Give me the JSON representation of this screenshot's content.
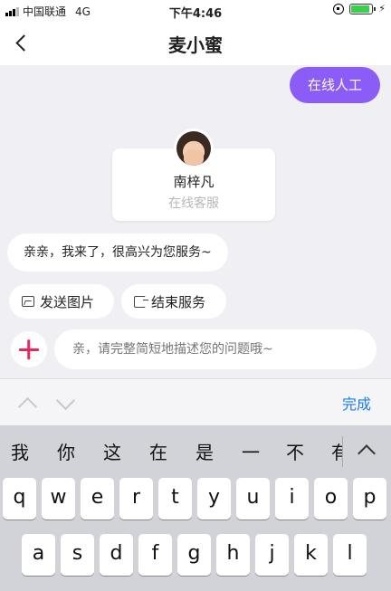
{
  "status_bar": {
    "carrier": "中国联通",
    "network": "4G",
    "time": "下午4:46",
    "battery_level": 0.9,
    "icons": [
      "signal-icon",
      "orientation-lock-icon",
      "battery-icon",
      "charging-icon"
    ]
  },
  "nav": {
    "title": "麦小蜜",
    "back_icon": "chevron-left-icon"
  },
  "chat": {
    "online_button_label": "在线人工",
    "agent_name": "南梓凡",
    "agent_role": "在线客服",
    "greeting": "亲亲，我来了，很高兴为您服务~"
  },
  "actions": {
    "send_image_label": "发送图片",
    "end_service_label": "结束服务"
  },
  "composer": {
    "placeholder": "亲，请完整简短地描述您的问题哦~"
  },
  "keyboard_bar": {
    "done_label": "完成"
  },
  "keyboard": {
    "candidates": [
      "我",
      "你",
      "这",
      "在",
      "是",
      "一",
      "不",
      "有"
    ],
    "row1": [
      "q",
      "w",
      "e",
      "r",
      "t",
      "y",
      "u",
      "i",
      "o",
      "p"
    ],
    "row2": [
      "a",
      "s",
      "d",
      "f",
      "g",
      "h",
      "j",
      "k",
      "l"
    ]
  },
  "colors": {
    "accent_purple": "#8b5cf6",
    "plus_red": "#e8265f",
    "done_blue": "#1a7bf2",
    "battery_green": "#3ccf4e"
  }
}
